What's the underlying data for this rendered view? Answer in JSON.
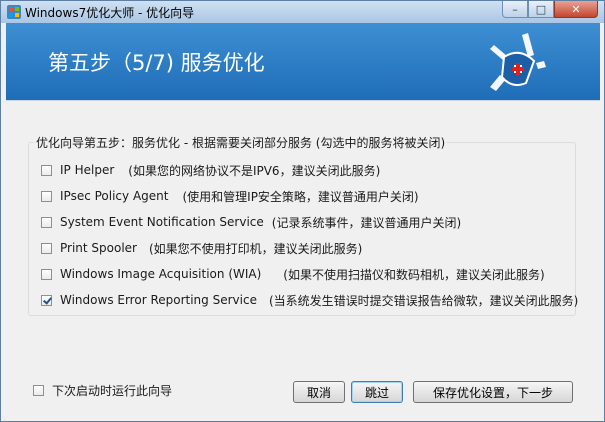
{
  "window": {
    "title": "Windows7优化大师 - 优化向导",
    "minimize_glyph": "–",
    "maximize_glyph": "□",
    "close_glyph": "✕"
  },
  "header": {
    "title": "第五步（5/7) 服务优化",
    "logo_icon": "swiss-army-knife-icon"
  },
  "group": {
    "label": "优化向导第五步：服务优化 - 根据需要关闭部分服务 (勾选中的服务将被关闭)",
    "items": [
      {
        "name": "IP Helper",
        "desc": "(如果您的网络协议不是IPV6，建议关闭此服务)",
        "checked": false
      },
      {
        "name": "IPsec Policy Agent",
        "desc": "(使用和管理IP安全策略，建议普通用户关闭)",
        "checked": false
      },
      {
        "name": "System Event Notification Service",
        "desc": "(记录系统事件，建议普通用户关闭)",
        "checked": false
      },
      {
        "name": "Print Spooler",
        "desc": "(如果您不使用打印机，建议关闭此服务)",
        "checked": false
      },
      {
        "name": "Windows Image Acquisition (WIA)",
        "desc": "(如果不使用扫描仪和数码相机，建议关闭此服务)",
        "checked": false
      },
      {
        "name": "Windows Error Reporting Service",
        "desc": "(当系统发生错误时提交错误报告给微软，建议关闭此服务)",
        "checked": true
      }
    ]
  },
  "footer": {
    "run_next_time_label": "下次启动时运行此向导",
    "run_next_time_checked": false,
    "cancel_label": "取消",
    "skip_label": "跳过",
    "save_next_label": "保存优化设置，下一步"
  },
  "colors": {
    "header_blue": "#2a7cc4",
    "window_bg": "#f0f0f0"
  }
}
